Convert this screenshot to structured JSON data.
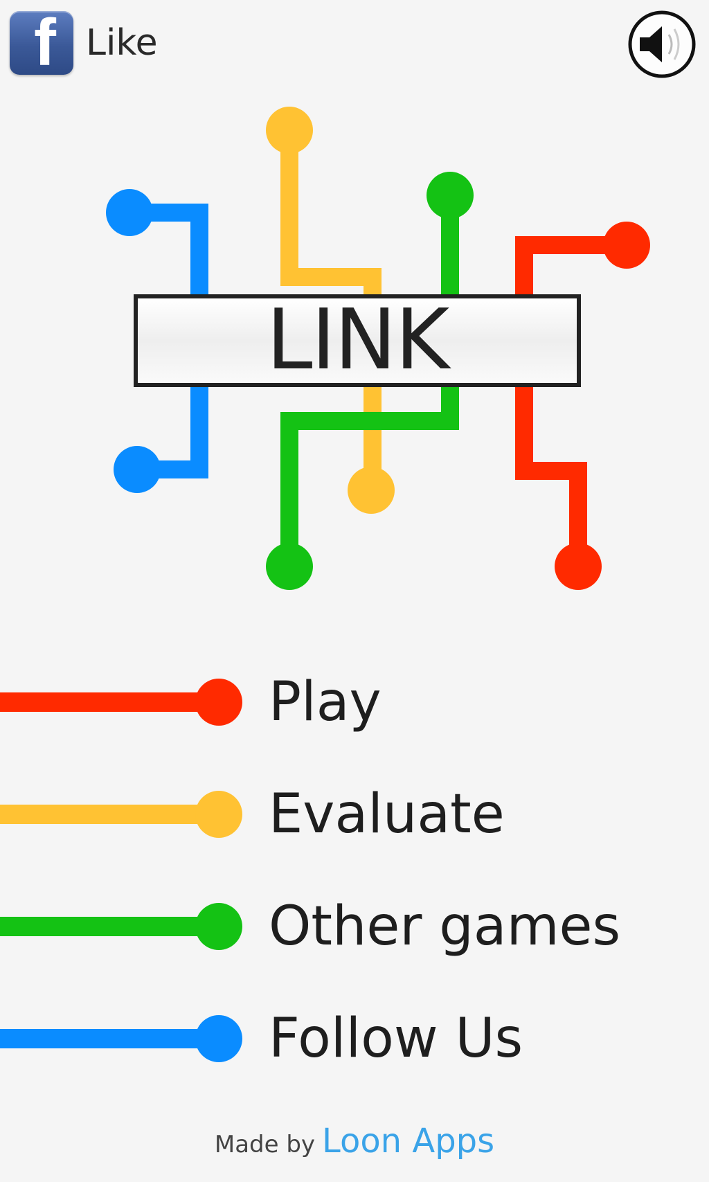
{
  "header": {
    "facebook": {
      "icon": "facebook-f-icon",
      "label": "Like"
    },
    "sound": {
      "icon": "speaker-icon"
    }
  },
  "logo": {
    "title": "LINK"
  },
  "colors": {
    "red": "#ff2a00",
    "yellow": "#ffc233",
    "green": "#14c214",
    "blue": "#0a8cff",
    "text": "#1e1e1e",
    "brand": "#3aa3e8"
  },
  "menu": {
    "items": [
      {
        "label": "Play",
        "color": "#ff2a00"
      },
      {
        "label": "Evaluate",
        "color": "#ffc233"
      },
      {
        "label": "Other games",
        "color": "#14c214"
      },
      {
        "label": "Follow Us",
        "color": "#0a8cff"
      }
    ]
  },
  "footer": {
    "made_by": "Made by",
    "brand": "Loon Apps"
  }
}
